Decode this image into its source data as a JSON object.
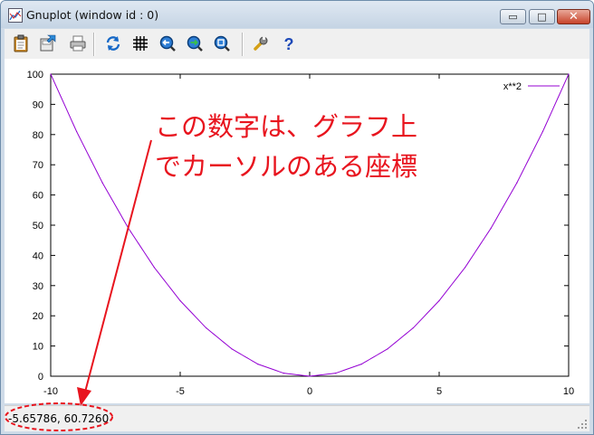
{
  "window": {
    "title": "Gnuplot (window id : 0)",
    "minimize_label": "▭",
    "maximize_label": "□",
    "close_label": "✕"
  },
  "toolbar": {
    "buttons": [
      {
        "name": "copy-to-clipboard",
        "icon": "clipboard-icon"
      },
      {
        "name": "save",
        "icon": "save-icon"
      },
      {
        "name": "print",
        "icon": "printer-icon"
      },
      {
        "name": "replot",
        "icon": "refresh-icon"
      },
      {
        "name": "grid",
        "icon": "grid-icon"
      },
      {
        "name": "previous-zoom",
        "icon": "zoom-previous-icon"
      },
      {
        "name": "next-zoom",
        "icon": "zoom-next-icon"
      },
      {
        "name": "autoscale",
        "icon": "zoom-autoscale-icon"
      },
      {
        "name": "options",
        "icon": "wrench-icon"
      },
      {
        "name": "help",
        "icon": "help-icon"
      }
    ]
  },
  "status": {
    "coordinates": "-5.65786,  60.7260"
  },
  "annotation": {
    "line1": "この数字は、グラフ上",
    "line2": "でカーソルのある座標",
    "color": "#e8141e"
  },
  "chart_data": {
    "type": "line",
    "title": "",
    "xlabel": "",
    "ylabel": "",
    "xlim": [
      -10,
      10
    ],
    "ylim": [
      0,
      100
    ],
    "xticks": [
      "-10",
      "-5",
      "0",
      "5",
      "10"
    ],
    "yticks": [
      "0",
      "10",
      "20",
      "30",
      "40",
      "50",
      "60",
      "70",
      "80",
      "90",
      "100"
    ],
    "legend_position": "top-right",
    "grid": false,
    "series": [
      {
        "name": "x**2",
        "color": "#9400d3",
        "x": [
          -10,
          -9,
          -8,
          -7,
          -6,
          -5,
          -4,
          -3,
          -2,
          -1,
          0,
          1,
          2,
          3,
          4,
          5,
          6,
          7,
          8,
          9,
          10
        ],
        "y": [
          100,
          81,
          64,
          49,
          36,
          25,
          16,
          9,
          4,
          1,
          0,
          1,
          4,
          9,
          16,
          25,
          36,
          49,
          64,
          81,
          100
        ]
      }
    ]
  }
}
